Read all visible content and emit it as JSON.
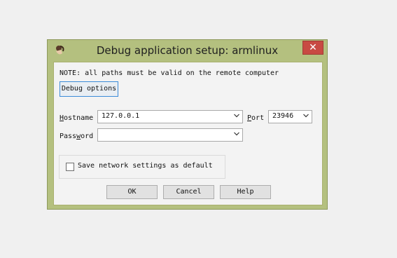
{
  "window": {
    "title": "Debug application setup: armlinux",
    "close_glyph": "✕"
  },
  "note": "NOTE: all paths must be valid on the remote computer",
  "debug_options_label": "Debug options",
  "hostname": {
    "label_prefix": "",
    "label_mnemonic": "H",
    "label_rest": "ostname",
    "value": "127.0.0.1"
  },
  "port": {
    "label_mnemonic": "P",
    "label_rest": "ort",
    "value": "23946"
  },
  "password": {
    "label_prefix": "Pass",
    "label_mnemonic": "w",
    "label_rest": "ord",
    "value": ""
  },
  "save_default": {
    "label": "Save network settings as default",
    "checked": false
  },
  "buttons": {
    "ok": "OK",
    "cancel": "Cancel",
    "help": "Help"
  },
  "icons": {
    "app": "ida-app-icon",
    "dropdown": "chevron-down-icon",
    "close": "close-icon"
  }
}
